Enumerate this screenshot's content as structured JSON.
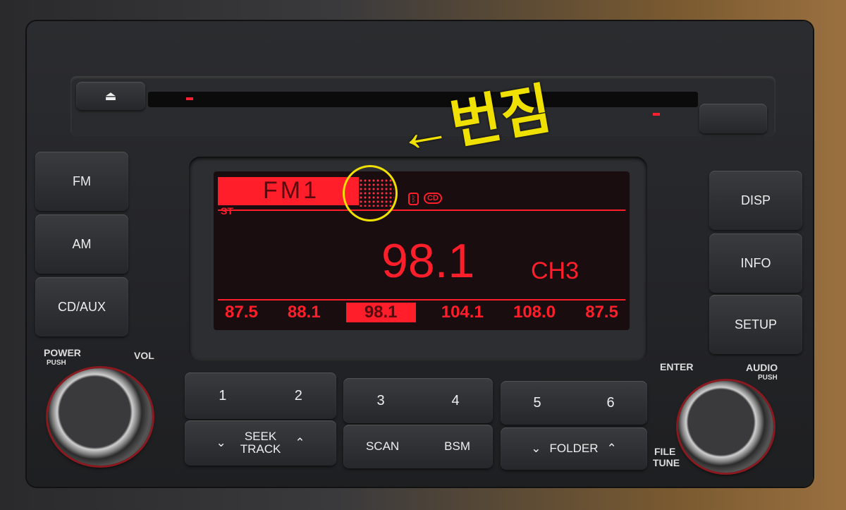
{
  "annotation": {
    "text": "←번짐",
    "color": "#f0e000"
  },
  "left_buttons": [
    {
      "label": "FM"
    },
    {
      "label": "AM"
    },
    {
      "label": "CD/AUX"
    }
  ],
  "right_buttons": [
    {
      "label": "DISP"
    },
    {
      "label": "INFO"
    },
    {
      "label": "SETUP"
    }
  ],
  "display": {
    "band": "FM1",
    "stereo": "ST",
    "frequency": "98.1",
    "channel": "CH3",
    "cd_icon": "CD",
    "presets": [
      "87.5",
      "88.1",
      "98.1",
      "104.1",
      "108.0",
      "87.5"
    ],
    "selected_preset": 2,
    "color": "#ff1e2a"
  },
  "knobs": {
    "power": "POWER",
    "power_push": "PUSH",
    "vol": "VOL",
    "enter": "ENTER",
    "audio": "AUDIO",
    "audio_push": "PUSH",
    "file": "FILE",
    "tune": "TUNE"
  },
  "bottom": {
    "p1": "1",
    "p2": "2",
    "p3": "3",
    "p4": "4",
    "p5": "5",
    "p6": "6",
    "seek": "SEEK",
    "track": "TRACK",
    "scan": "SCAN",
    "bsm": "BSM",
    "folder": "FOLDER"
  },
  "eject_icon": "eject-icon"
}
